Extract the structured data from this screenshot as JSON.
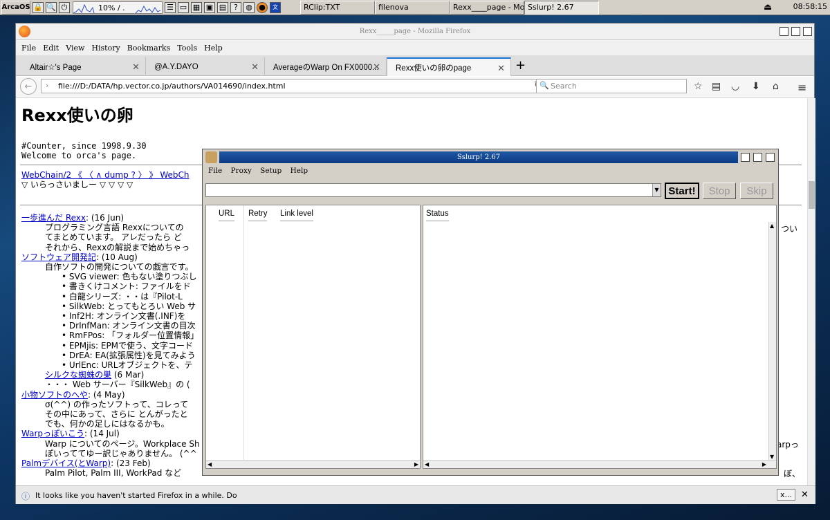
{
  "taskbar": {
    "start": "ArcaOS",
    "cpu": "10% / .",
    "clock": "08:58:15",
    "tasks": [
      "RClip:TXT",
      "filenova",
      "Rexx____page - Mozi",
      "Sslurp! 2.67"
    ]
  },
  "firefox": {
    "title": "Rexx_____page - Mozilla Firefox",
    "menu": [
      "File",
      "Edit",
      "View",
      "History",
      "Bookmarks",
      "Tools",
      "Help"
    ],
    "tabs": [
      "Altair☆'s Page",
      "@A.Y.DAYO",
      "AverageのWarp On FX0000...",
      "Rexx使いの卵のpage"
    ],
    "url": "file:///D:/DATA/hp.vector.co.jp/authors/VA014690/index.html",
    "search_placeholder": "Search",
    "notification": "It looks like you haven't started Firefox in a while. Do",
    "notification_btn": "x...",
    "page": {
      "heading": "Rexx使いの卵",
      "counter": "#Counter, since 1998.9.30",
      "welcome": "Welcome to orca's page.",
      "webchain": "WebChain/2 《 〈 ∧ dump ? 〉 》 WebCh",
      "irasshai": "▽ いらっさいましー ▽ ▽ ▽ ▽",
      "lines": [
        {
          "indent": 0,
          "link": "一歩進んだ Rexx",
          "text": ": (16 Jun)"
        },
        {
          "indent": 1,
          "link": "",
          "text": "プログラミング言語 Rexxについての"
        },
        {
          "indent": 1,
          "link": "",
          "text": "てまとめています。 アレだったら ど"
        },
        {
          "indent": 1,
          "link": "",
          "text": "それから、Rexxの解説まで始めちゃっ"
        },
        {
          "indent": 0,
          "link": "ソフトウェア開発記",
          "text": ": (10 Aug)"
        },
        {
          "indent": 1,
          "link": "",
          "text": "自作ソフトの開発についての戯言です。"
        },
        {
          "indent": 2,
          "link": "",
          "text": "SVG viewer: 色もない塗りつぶし"
        },
        {
          "indent": 2,
          "link": "",
          "text": "書きくけコメント: ファイルをド"
        },
        {
          "indent": 2,
          "link": "",
          "text": "白龍シリーズ: ・・は『Pilot-L"
        },
        {
          "indent": 2,
          "link": "",
          "text": "SilkWeb: とってもとろい Web サ"
        },
        {
          "indent": 2,
          "link": "",
          "text": "Inf2H: オンライン文書(.INF)を"
        },
        {
          "indent": 2,
          "link": "",
          "text": "DrInfMan: オンライン文書の目次"
        },
        {
          "indent": 2,
          "link": "",
          "text": "RmFPos: 「フォルダー位置情報」"
        },
        {
          "indent": 2,
          "link": "",
          "text": "EPMjis: EPMで使う、文字コード"
        },
        {
          "indent": 2,
          "link": "",
          "text": "DrEA: EA(拡張属性)を見てみよう"
        },
        {
          "indent": 2,
          "link": "",
          "text": "UrlEnc: URLオブジェクトを、テ"
        },
        {
          "indent": 1,
          "link": "シルクな蜘蛛の巣",
          "text": " (6 Mar)"
        },
        {
          "indent": 1,
          "link": "",
          "text": "・・・ Web サーバー『SilkWeb』の ("
        },
        {
          "indent": 0,
          "link": "小物ソフトのへや",
          "text": ": (4 May)"
        },
        {
          "indent": 1,
          "link": "",
          "text": "σ(^^) の作ったソフトって、コレって"
        },
        {
          "indent": 1,
          "link": "",
          "text": "その中にあって、さらに とんがったと"
        },
        {
          "indent": 1,
          "link": "",
          "text": "でも、何かの足しにはなるかも。"
        },
        {
          "indent": 0,
          "link": "Warpっぽいこう",
          "text": ": (14 Jul)"
        },
        {
          "indent": 1,
          "link": "",
          "text": "Warp についてのページ。Workplace Sh"
        },
        {
          "indent": 1,
          "link": "",
          "text": "ぽいっててゆー訳じゃありません。 (^^"
        },
        {
          "indent": 0,
          "link": "Palmデバイス(とWarp)",
          "text": ": (23 Feb)"
        },
        {
          "indent": 1,
          "link": "",
          "text": "Palm Pilot, Palm III, WorkPad など"
        }
      ],
      "right_frag": [
        "つい",
        "arpっ",
        "ぼ、"
      ]
    }
  },
  "sslurp": {
    "title": "Sslurp! 2.67",
    "menu": [
      "File",
      "Proxy",
      "Setup",
      "Help"
    ],
    "combo_value": "",
    "buttons": {
      "start": "Start!",
      "stop": "Stop",
      "skip": "Skip"
    },
    "columns": {
      "url": "URL",
      "retry": "Retry",
      "link_level": "Link level",
      "status": "Status"
    }
  }
}
